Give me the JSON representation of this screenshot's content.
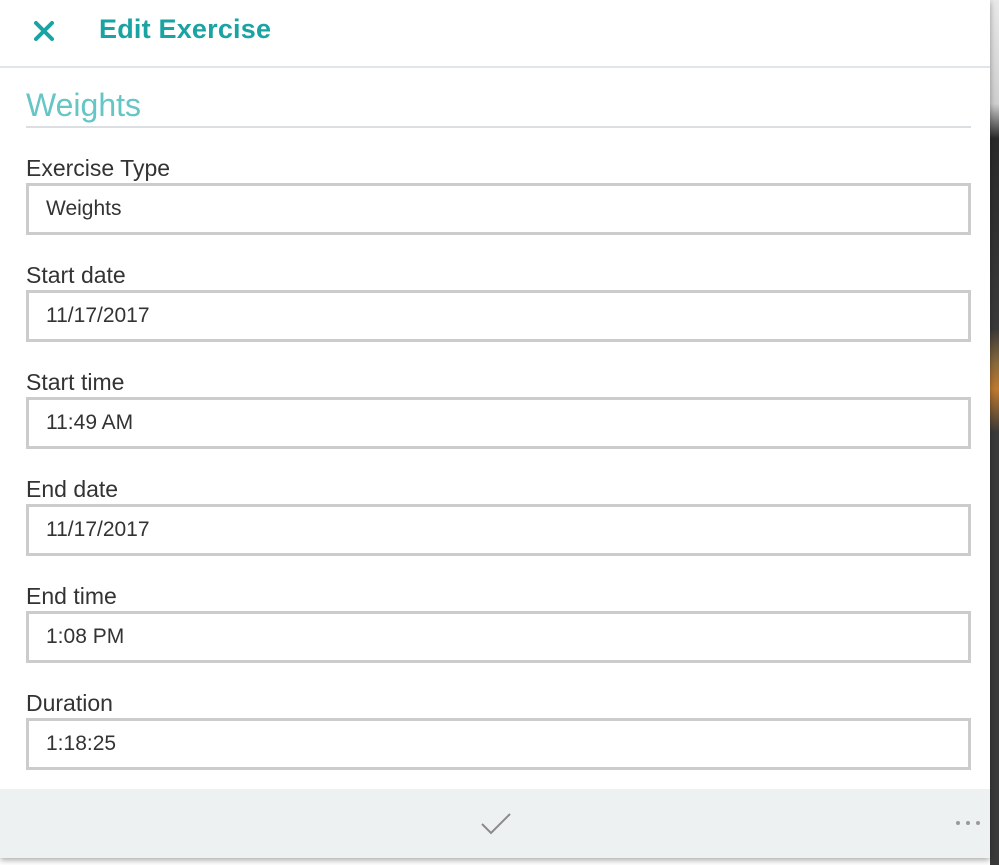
{
  "header": {
    "title": "Edit Exercise",
    "close_icon": "close-icon"
  },
  "section": {
    "title": "Weights"
  },
  "fields": [
    {
      "label": "Exercise Type",
      "value": "Weights"
    },
    {
      "label": "Start date",
      "value": "11/17/2017"
    },
    {
      "label": "Start time",
      "value": "11:49 AM"
    },
    {
      "label": "End date",
      "value": "11/17/2017"
    },
    {
      "label": "End time",
      "value": "1:08 PM"
    },
    {
      "label": "Duration",
      "value": "1:18:25"
    }
  ],
  "footer": {
    "save_icon": "checkmark-icon",
    "more_icon": "more-options-icon"
  },
  "colors": {
    "accent": "#1aa3a3",
    "section_title": "#66c5c5",
    "input_border": "#cccccc",
    "footer_bg": "#eef1f2"
  }
}
